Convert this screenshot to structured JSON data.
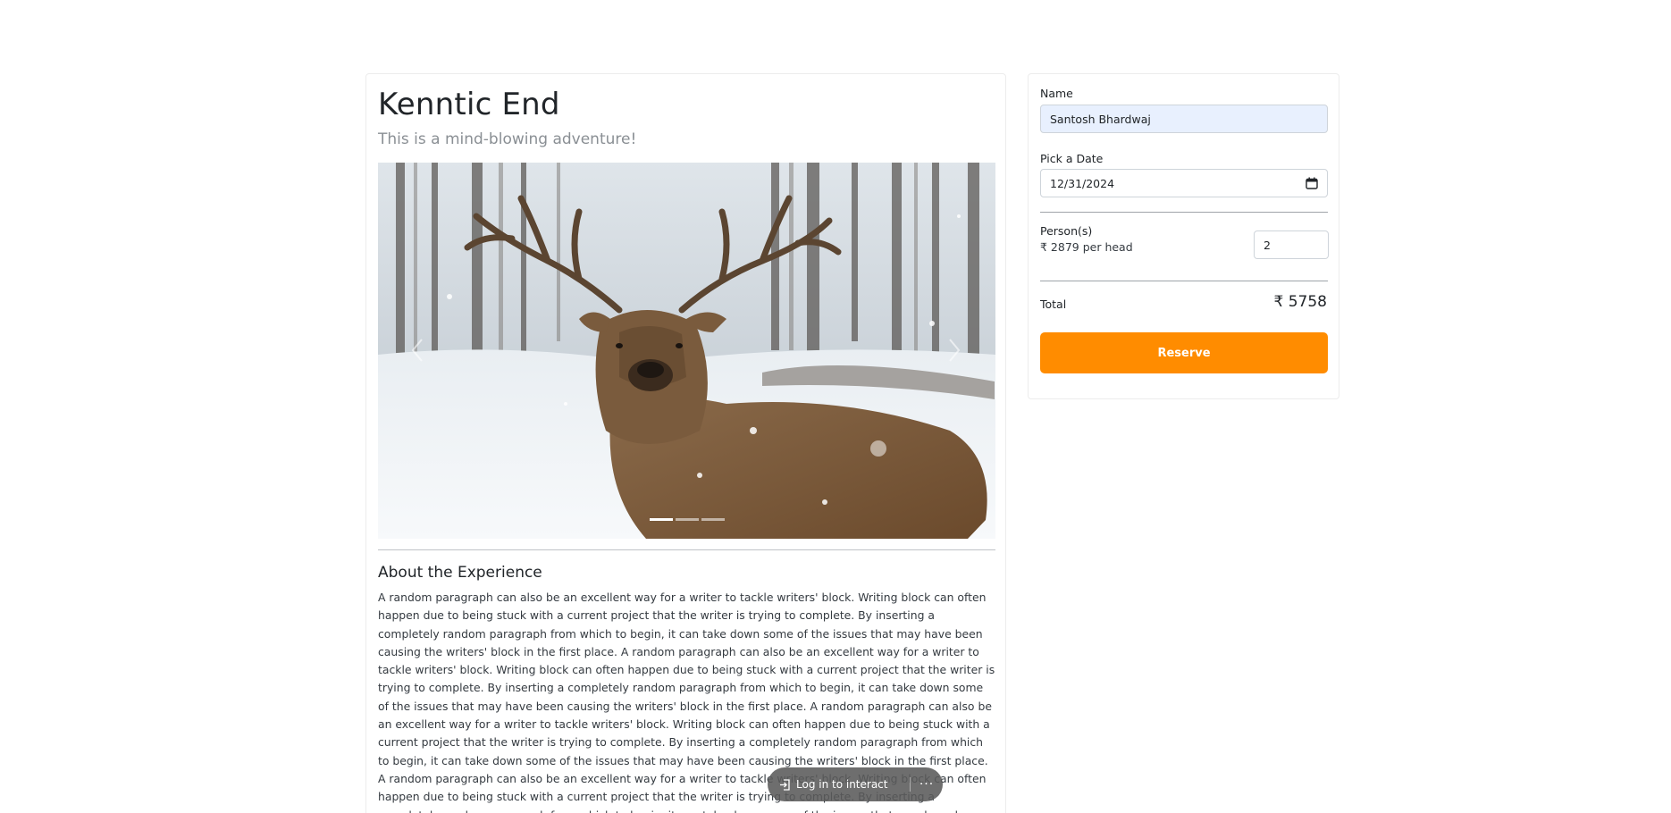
{
  "experience": {
    "title": "Kenntic End",
    "subtitle": "This is a mind-blowing adventure!",
    "carousel": {
      "slide_count": 3,
      "active_index": 0
    },
    "about_heading": "About the Experience",
    "about_text": "A random paragraph can also be an excellent way for a writer to tackle writers' block. Writing block can often happen due to being stuck with a current project that the writer is trying to complete. By inserting a completely random paragraph from which to begin, it can take down some of the issues that may have been causing the writers' block in the first place. A random paragraph can also be an excellent way for a writer to tackle writers' block. Writing block can often happen due to being stuck with a current project that the writer is trying to complete. By inserting a completely random paragraph from which to begin, it can take down some of the issues that may have been causing the writers' block in the first place. A random paragraph can also be an excellent way for a writer to tackle writers' block. Writing block can often happen due to being stuck with a current project that the writer is trying to complete. By inserting a completely random paragraph from which to begin, it can take down some of the issues that may have been causing the writers' block in the first place. A random paragraph can also be an excellent way for a writer to tackle writers' block. Writing block can often happen due to being stuck with a current project that the writer is trying to complete. By inserting a completely random paragraph from which to begin, it can take down some of the issues that may have been causing the writers' block in the first place. A random paragraph can"
  },
  "booking": {
    "name_label": "Name",
    "name_value": "Santosh Bhardwaj",
    "date_label": "Pick a Date",
    "date_value": "12/31/2024",
    "persons_label": "Person(s)",
    "per_head_text": "₹ 2879 per head",
    "persons_value": "2",
    "total_label": "Total",
    "total_value": "₹ 5758",
    "reserve_label": "Reserve"
  },
  "toolbar": {
    "login_label": "Log in to interact",
    "more_label": "···"
  },
  "colors": {
    "accent": "#ff8c00",
    "autofill": "#e8f0fe"
  }
}
